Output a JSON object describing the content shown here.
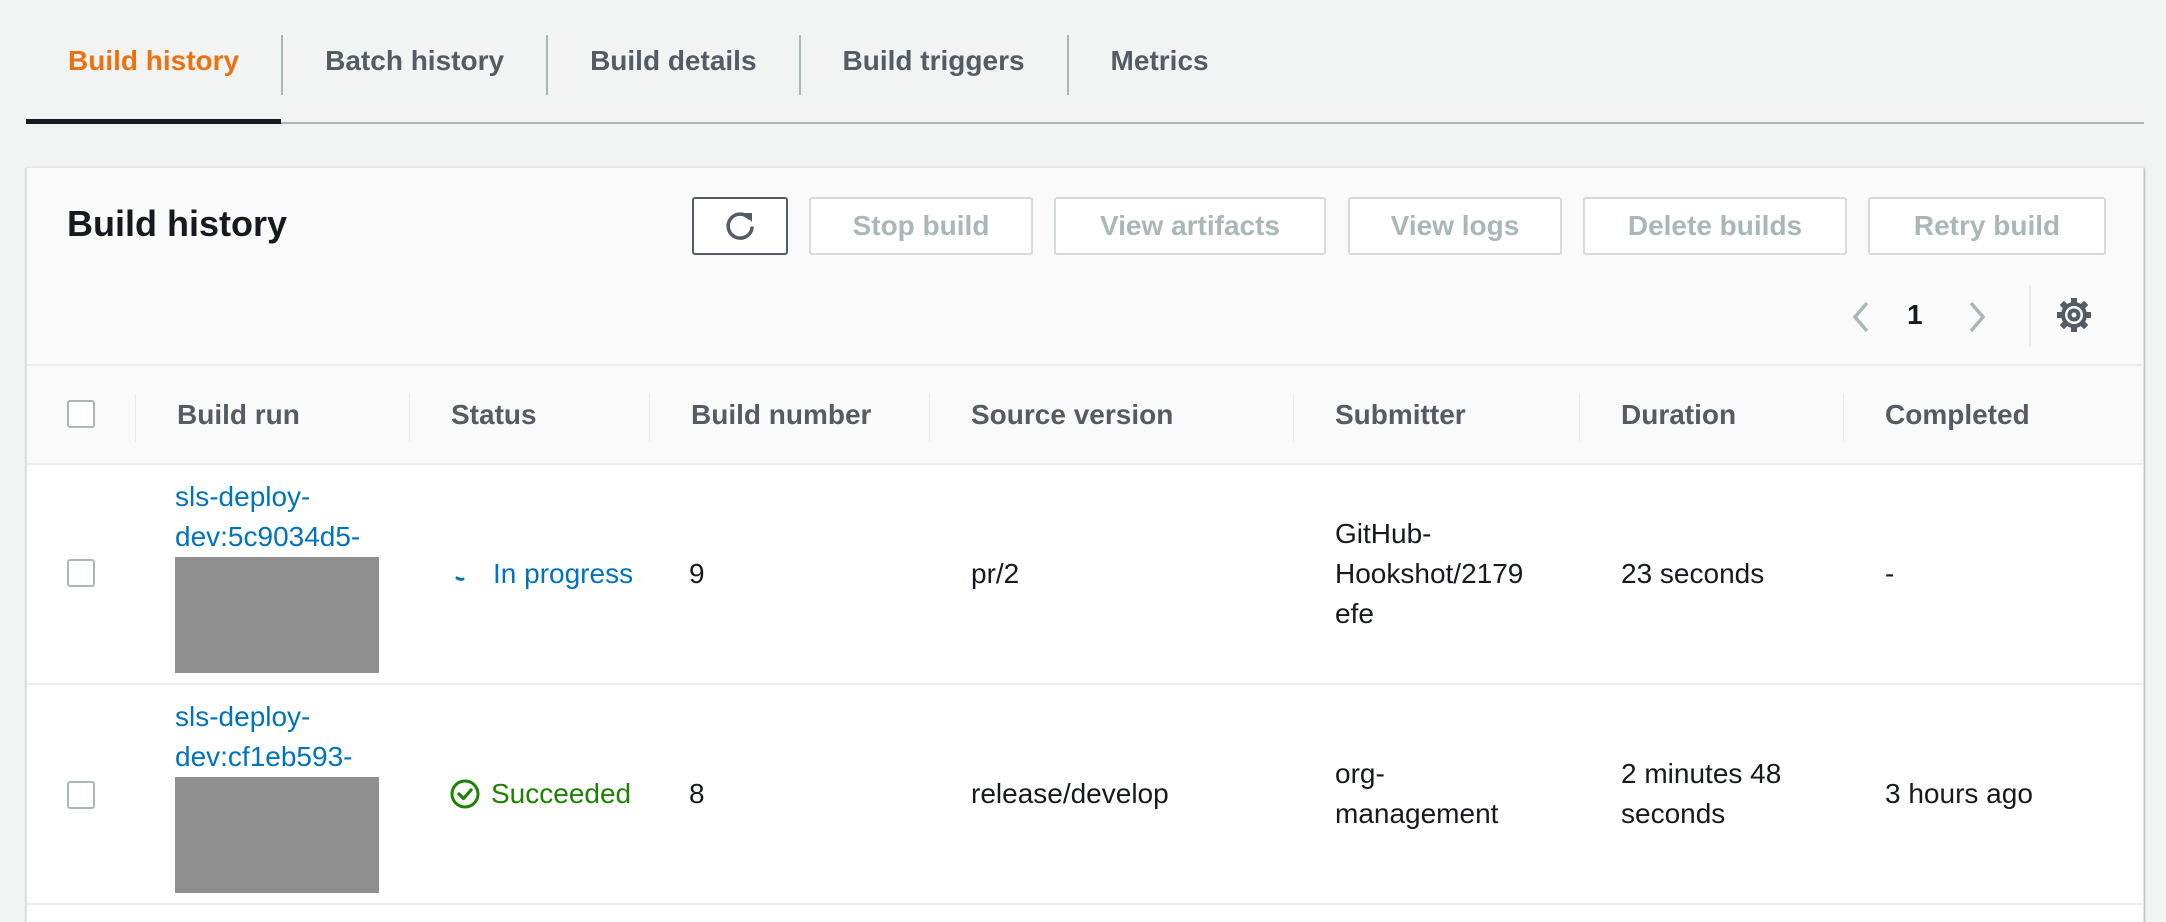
{
  "tabs": [
    {
      "label": "Build history",
      "active": true
    },
    {
      "label": "Batch history",
      "active": false
    },
    {
      "label": "Build details",
      "active": false
    },
    {
      "label": "Build triggers",
      "active": false
    },
    {
      "label": "Metrics",
      "active": false
    }
  ],
  "panel": {
    "title": "Build history",
    "toolbar": {
      "refresh_icon": "refresh-icon",
      "stop_build": "Stop build",
      "view_artifacts": "View artifacts",
      "view_logs": "View logs",
      "delete_builds": "Delete builds",
      "retry_build": "Retry build"
    },
    "pagination": {
      "current_page": "1",
      "prev_icon": "chevron-left-icon",
      "next_icon": "chevron-right-icon",
      "settings_icon": "gear-icon"
    }
  },
  "table": {
    "columns": [
      "Build run",
      "Status",
      "Build number",
      "Source version",
      "Submitter",
      "Duration",
      "Completed"
    ],
    "rows": [
      {
        "build_run_line1": "sls-deploy-",
        "build_run_line2": "dev:5c9034d5-",
        "status": "In progress",
        "status_icon": "spinner-icon",
        "build_number": "9",
        "source_version": "pr/2",
        "submitter_line1": "GitHub-",
        "submitter_line2": "Hookshot/2179",
        "submitter_line3": "efe",
        "duration_line1": "23 seconds",
        "duration_line2": "",
        "completed": "-"
      },
      {
        "build_run_line1": "sls-deploy-",
        "build_run_line2": "dev:cf1eb593-",
        "status": "Succeeded",
        "status_icon": "check-circle-icon",
        "build_number": "8",
        "source_version": "release/develop",
        "submitter_line1": "org-",
        "submitter_line2": "management",
        "submitter_line3": "",
        "duration_line1": "2 minutes 48",
        "duration_line2": "seconds",
        "completed": "3 hours ago"
      }
    ]
  },
  "colors": {
    "active_tab": "#ec7211",
    "link": "#0073bb",
    "success": "#1d8102",
    "disabled_text": "#aab7b8"
  }
}
